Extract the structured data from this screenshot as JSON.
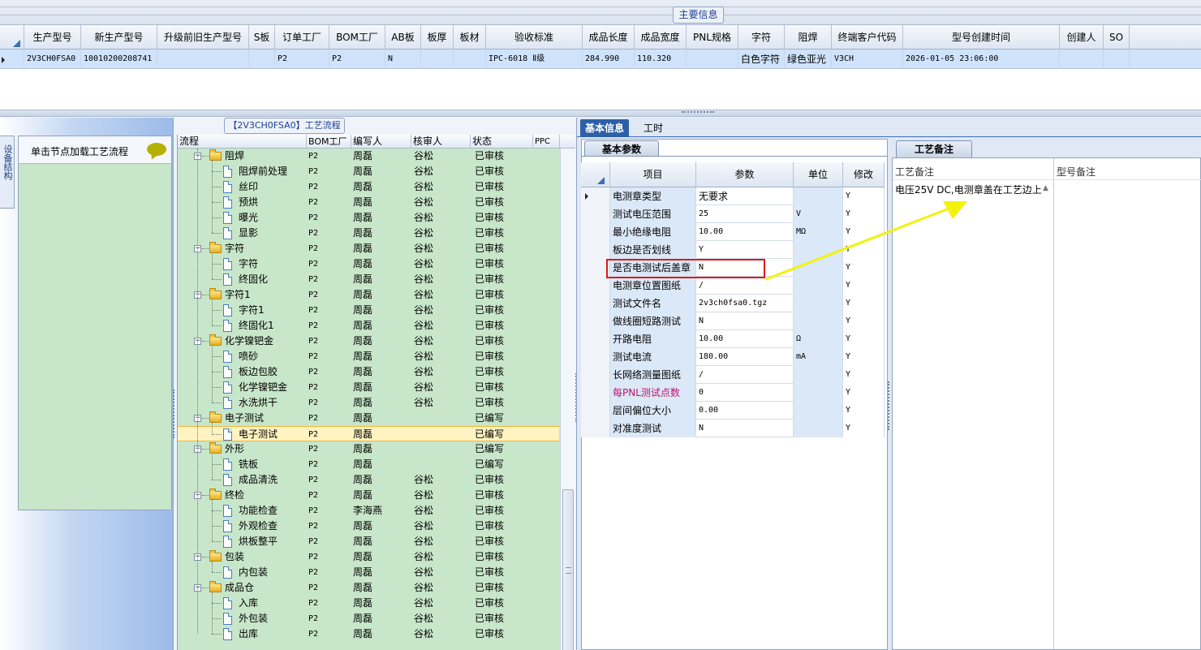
{
  "top": {
    "section_tab": "主要信息",
    "columns": [
      "生产型号",
      "新生产型号",
      "升级前旧生产型号",
      "S板",
      "订单工厂",
      "BOM工厂",
      "AB板",
      "板厚",
      "板材",
      "验收标准",
      "成品长度",
      "成品宽度",
      "PNL规格",
      "字符",
      "阻焊",
      "终端客户代码",
      "型号创建时间",
      "创建人",
      "SO"
    ],
    "row": {
      "prod_model": "2V3CH0FSA0",
      "new_model": "10010200208741",
      "old_model": "",
      "s_board": "",
      "order_factory": "P2",
      "bom_factory": "P2",
      "ab_board": "N",
      "thickness": "",
      "material": "",
      "standard": "IPC-6018 Ⅱ级",
      "length": "284.990",
      "width": "110.320",
      "pnl": "",
      "char": "白色字符",
      "solder": "绿色亚光",
      "customer": "V3CH",
      "created": "2026-01-05 23:06:00",
      "creator": "",
      "so": ""
    }
  },
  "left": {
    "side_tab": "设备结构",
    "load_label": "单击节点加载工艺流程"
  },
  "tree": {
    "caption": "【2V3CH0FSA0】工艺流程",
    "headers": [
      "流程",
      "BOM工厂",
      "编写人",
      "核审人",
      "状态",
      "PPC"
    ],
    "rows": [
      {
        "name": "阻焊",
        "level": 0,
        "bom": "P2",
        "writer": "周磊",
        "reviewer": "谷松",
        "status": "已审核"
      },
      {
        "name": "阻焊前处理",
        "level": 1,
        "bom": "P2",
        "writer": "周磊",
        "reviewer": "谷松",
        "status": "已审核"
      },
      {
        "name": "丝印",
        "level": 1,
        "bom": "P2",
        "writer": "周磊",
        "reviewer": "谷松",
        "status": "已审核"
      },
      {
        "name": "预烘",
        "level": 1,
        "bom": "P2",
        "writer": "周磊",
        "reviewer": "谷松",
        "status": "已审核"
      },
      {
        "name": "曝光",
        "level": 1,
        "bom": "P2",
        "writer": "周磊",
        "reviewer": "谷松",
        "status": "已审核"
      },
      {
        "name": "显影",
        "level": 1,
        "bom": "P2",
        "writer": "周磊",
        "reviewer": "谷松",
        "status": "已审核"
      },
      {
        "name": "字符",
        "level": 0,
        "bom": "P2",
        "writer": "周磊",
        "reviewer": "谷松",
        "status": "已审核"
      },
      {
        "name": "字符",
        "level": 1,
        "bom": "P2",
        "writer": "周磊",
        "reviewer": "谷松",
        "status": "已审核"
      },
      {
        "name": "终固化",
        "level": 1,
        "bom": "P2",
        "writer": "周磊",
        "reviewer": "谷松",
        "status": "已审核"
      },
      {
        "name": "字符1",
        "level": 0,
        "bom": "P2",
        "writer": "周磊",
        "reviewer": "谷松",
        "status": "已审核"
      },
      {
        "name": "字符1",
        "level": 1,
        "bom": "P2",
        "writer": "周磊",
        "reviewer": "谷松",
        "status": "已审核"
      },
      {
        "name": "终固化1",
        "level": 1,
        "bom": "P2",
        "writer": "周磊",
        "reviewer": "谷松",
        "status": "已审核"
      },
      {
        "name": "化学镍钯金",
        "level": 0,
        "bom": "P2",
        "writer": "周磊",
        "reviewer": "谷松",
        "status": "已审核"
      },
      {
        "name": "喷砂",
        "level": 1,
        "bom": "P2",
        "writer": "周磊",
        "reviewer": "谷松",
        "status": "已审核"
      },
      {
        "name": "板边包胶",
        "level": 1,
        "bom": "P2",
        "writer": "周磊",
        "reviewer": "谷松",
        "status": "已审核"
      },
      {
        "name": "化学镍钯金",
        "level": 1,
        "bom": "P2",
        "writer": "周磊",
        "reviewer": "谷松",
        "status": "已审核"
      },
      {
        "name": "水洗烘干",
        "level": 1,
        "bom": "P2",
        "writer": "周磊",
        "reviewer": "谷松",
        "status": "已审核"
      },
      {
        "name": "电子测试",
        "level": 0,
        "bom": "P2",
        "writer": "周磊",
        "reviewer": "",
        "status": "已编写"
      },
      {
        "name": "电子测试",
        "level": 1,
        "bom": "P2",
        "writer": "周磊",
        "reviewer": "",
        "status": "已编写",
        "selected": true
      },
      {
        "name": "外形",
        "level": 0,
        "bom": "P2",
        "writer": "周磊",
        "reviewer": "",
        "status": "已编写"
      },
      {
        "name": "铣板",
        "level": 1,
        "bom": "P2",
        "writer": "周磊",
        "reviewer": "",
        "status": "已编写"
      },
      {
        "name": "成品清洗",
        "level": 1,
        "bom": "P2",
        "writer": "周磊",
        "reviewer": "谷松",
        "status": "已审核"
      },
      {
        "name": "终检",
        "level": 0,
        "bom": "P2",
        "writer": "周磊",
        "reviewer": "谷松",
        "status": "已审核"
      },
      {
        "name": "功能检查",
        "level": 1,
        "bom": "P2",
        "writer": "李海燕",
        "reviewer": "谷松",
        "status": "已审核"
      },
      {
        "name": "外观检查",
        "level": 1,
        "bom": "P2",
        "writer": "周磊",
        "reviewer": "谷松",
        "status": "已审核"
      },
      {
        "name": "烘板整平",
        "level": 1,
        "bom": "P2",
        "writer": "周磊",
        "reviewer": "谷松",
        "status": "已审核"
      },
      {
        "name": "包装",
        "level": 0,
        "bom": "P2",
        "writer": "周磊",
        "reviewer": "谷松",
        "status": "已审核"
      },
      {
        "name": "内包装",
        "level": 1,
        "bom": "P2",
        "writer": "周磊",
        "reviewer": "谷松",
        "status": "已审核"
      },
      {
        "name": "成品仓",
        "level": 0,
        "bom": "P2",
        "writer": "周磊",
        "reviewer": "谷松",
        "status": "已审核"
      },
      {
        "name": "入库",
        "level": 1,
        "bom": "P2",
        "writer": "周磊",
        "reviewer": "谷松",
        "status": "已审核"
      },
      {
        "name": "外包装",
        "level": 1,
        "bom": "P2",
        "writer": "周磊",
        "reviewer": "谷松",
        "status": "已审核"
      },
      {
        "name": "出库",
        "level": 1,
        "bom": "P2",
        "writer": "周磊",
        "reviewer": "谷松",
        "status": "已审核"
      }
    ]
  },
  "right": {
    "tabs": [
      "基本信息",
      "工时"
    ],
    "params_tab": "基本参数",
    "param_headers": [
      "项目",
      "参数",
      "单位",
      "修改"
    ],
    "params": [
      {
        "item": "电测章类型",
        "value": "无要求",
        "unit": "",
        "mod": "Y"
      },
      {
        "item": "测试电压范围",
        "value": "25",
        "unit": "V",
        "mod": "Y"
      },
      {
        "item": "最小绝缘电阻",
        "value": "10.00",
        "unit": "MΩ",
        "mod": "Y"
      },
      {
        "item": "板边是否划线",
        "value": "Y",
        "unit": "",
        "mod": "Y"
      },
      {
        "item": "是否电测试后盖章",
        "value": "N",
        "unit": "",
        "mod": "Y"
      },
      {
        "item": "电测章位置图纸",
        "value": "/",
        "unit": "",
        "mod": "Y"
      },
      {
        "item": "测试文件名",
        "value": "2v3ch0fsa0.tgz",
        "unit": "",
        "mod": "Y"
      },
      {
        "item": "做线圈短路测试",
        "value": "N",
        "unit": "",
        "mod": "Y"
      },
      {
        "item": "开路电阻",
        "value": "10.00",
        "unit": "Ω",
        "mod": "Y"
      },
      {
        "item": "测试电流",
        "value": "180.00",
        "unit": "mA",
        "mod": "Y"
      },
      {
        "item": "长网络测量图纸",
        "value": "/",
        "unit": "",
        "mod": "Y"
      },
      {
        "item": "每PNL测试点数",
        "value": "0",
        "unit": "",
        "mod": "Y",
        "magenta": true
      },
      {
        "item": "层间偏位大小",
        "value": "0.00",
        "unit": "",
        "mod": "Y"
      },
      {
        "item": "对准度测试",
        "value": "N",
        "unit": "",
        "mod": "Y"
      }
    ],
    "notes_tab": "工艺备注",
    "notes_headers": [
      "工艺备注",
      "型号备注"
    ],
    "process_note": "电压25V DC,电测章盖在工艺边上"
  },
  "colors": {
    "tree_bg": "#c8e6c9",
    "selection": "#cfe3fb",
    "accent": "#2d5fa8",
    "highlight": "#e01818",
    "arrow": "#f2f20a"
  }
}
